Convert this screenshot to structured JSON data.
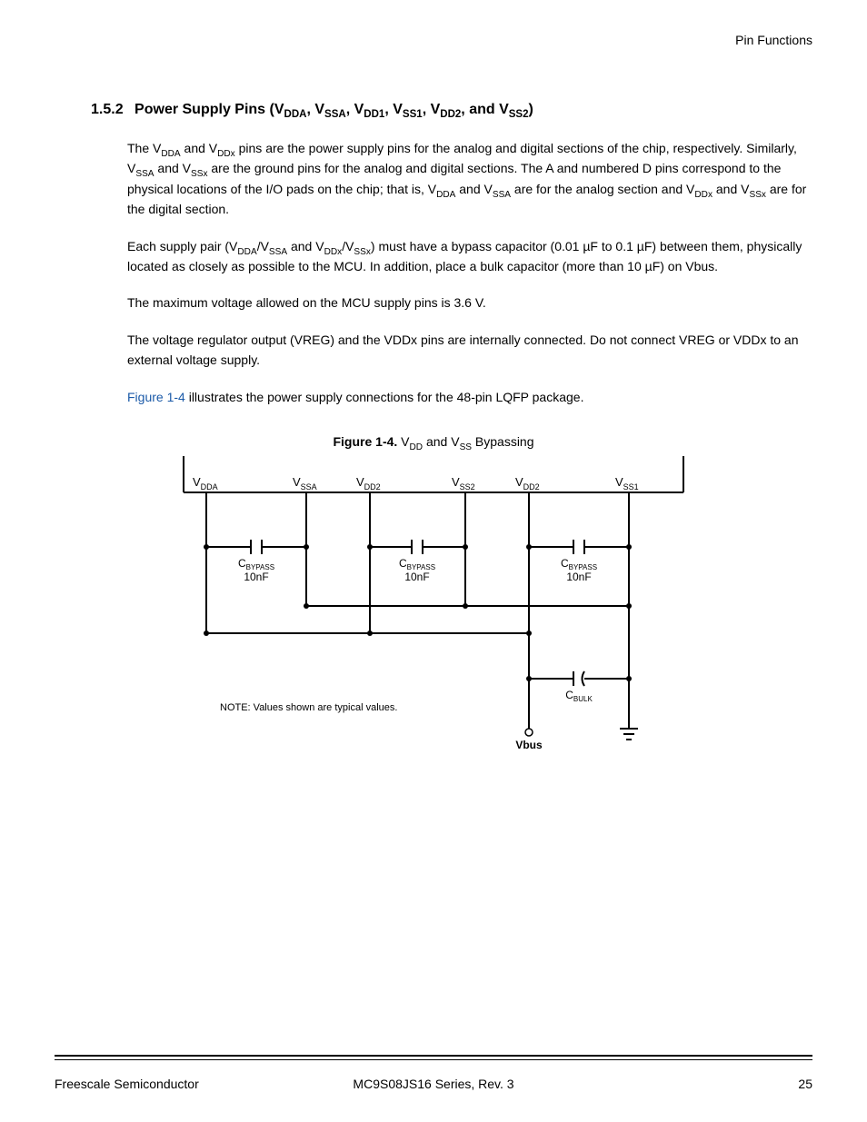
{
  "header": {
    "running_head": "Pin Functions"
  },
  "section": {
    "number": "1.5.2",
    "title_html": "Power Supply Pins (V<sub>DDA</sub>, V<sub>SSA</sub>, V<sub>DD1</sub>, V<sub>SS1</sub>, V<sub>DD2</sub>, and V<sub>SS2</sub>)"
  },
  "paragraphs": [
    "The V<sub>DDA</sub> and V<sub>DDx</sub> pins are the power supply pins for the analog and digital sections of the chip, respectively. Similarly, V<sub>SSA</sub> and V<sub>SSx</sub> are the ground pins for the analog and digital sections. The A and numbered D pins correspond to the physical locations of the I/O pads on the chip; that is, V<sub>DDA</sub> and V<sub>SSA</sub> are for the analog section and V<sub>DDx</sub> and V<sub>SSx</sub> are for the digital section.",
    "Each supply pair (V<sub>DDA</sub>/V<sub>SSA</sub> and V<sub>DDx</sub>/V<sub>SSx</sub>) must have a bypass capacitor (0.01 µF to 0.1 µF) between them, physically located as closely as possible to the MCU. In addition, place a bulk capacitor (more than 10 µF) on Vbus.",
    "The maximum voltage allowed on the MCU supply pins is 3.6 V.",
    "The voltage regulator output (VREG) and the VDDx pins are internally connected. Do not connect VREG or VDDx to an external voltage supply.",
    "<span class=\"figure-ref\">Figure 1-4</span> illustrates the power supply connections for the 48-pin LQFP package."
  ],
  "figure": {
    "caption_html": "<strong>Figure 1-4.</strong> V<sub>DD</sub> and V<sub>SS</sub> Bypassing",
    "pins": [
      {
        "main": "V",
        "sub": "DDA"
      },
      {
        "main": "V",
        "sub": "SSA"
      },
      {
        "main": "V",
        "sub": "DD2"
      },
      {
        "main": "V",
        "sub": "SS2"
      },
      {
        "main": "V",
        "sub": "DD2"
      },
      {
        "main": "V",
        "sub": "SS1"
      }
    ],
    "cbypass_label_main": "C",
    "cbypass_label_sub": "BYPASS",
    "cbypass_value": "10nF",
    "cbulk_main": "C",
    "cbulk_sub": "BULK",
    "note": "NOTE: Values shown are typical values.",
    "vbus": "Vbus"
  },
  "footer": {
    "docnum": "MC9S08JS16 Series, Rev. 3",
    "vendor": "Freescale Semiconductor",
    "page": "25"
  }
}
